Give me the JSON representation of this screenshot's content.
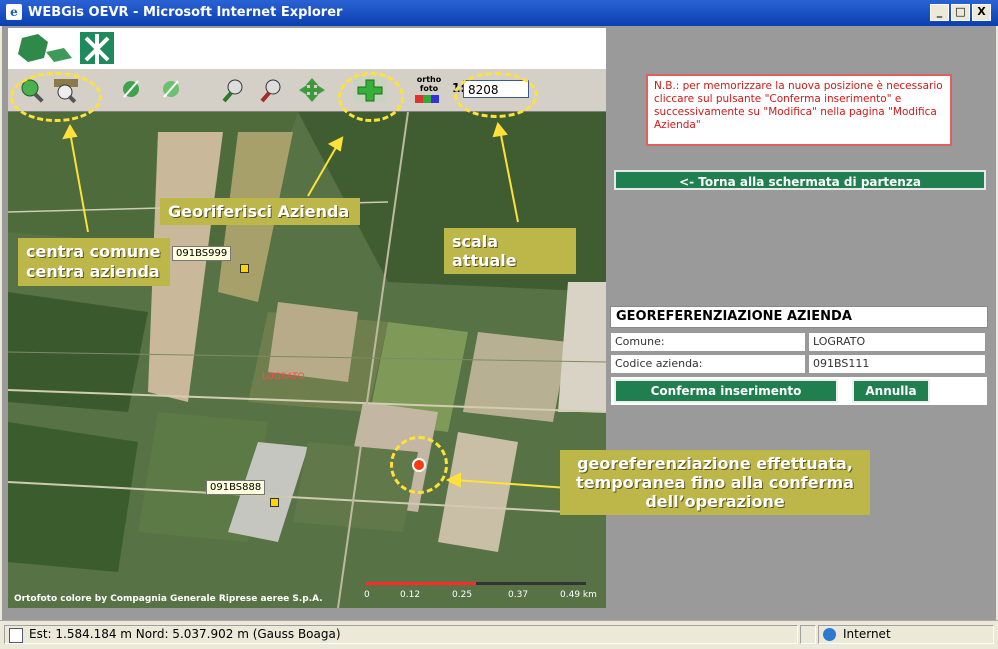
{
  "window": {
    "title": "WEBGis OEVR - Microsoft Internet Explorer",
    "btn_min": "_",
    "btn_max": "□",
    "btn_close": "X"
  },
  "toolbar": {
    "ortho_label": "ortho foto",
    "scale_prefix": "1:",
    "scale_value": "8208"
  },
  "map": {
    "callouts": {
      "center": "centra comune\ncentra azienda",
      "georef": "Georiferisci Azienda",
      "scale": "scala attuale",
      "done": "georeferenziazione effettuata,\ntemporanea fino alla conferma\ndell’operazione"
    },
    "markers": [
      "091BS999",
      "091BS888"
    ],
    "place_label": "LOGRATO",
    "attribution": "Ortofoto colore by Compagnia Generale Riprese aeree S.p.A.",
    "scale_ticks": [
      "0",
      "0.12",
      "0.25",
      "0.37",
      "0.49 km"
    ]
  },
  "side": {
    "note": "N.B.: per memorizzare la nuova posizione è necessario cliccare sul pulsante \"Conferma inserimento\" e successivamente su \"Modifica\" nella pagina \"Modifica Azienda\"",
    "back": "<- Torna alla schermata di partenza"
  },
  "panel": {
    "title": "GEOREFERENZIAZIONE AZIENDA",
    "comune_label": "Comune:",
    "comune_value": "LOGRATO",
    "codice_label": "Codice azienda:",
    "codice_value": "091BS111",
    "confirm": "Conferma inserimento",
    "cancel": "Annulla"
  },
  "status": {
    "coords": "Est: 1.584.184 m   Nord: 5.037.902 m   (Gauss Boaga)",
    "zone": "Internet"
  },
  "colors": {
    "accent_green": "#1f7f4e",
    "callout": "#bdb648",
    "note_red": "#d01818"
  }
}
